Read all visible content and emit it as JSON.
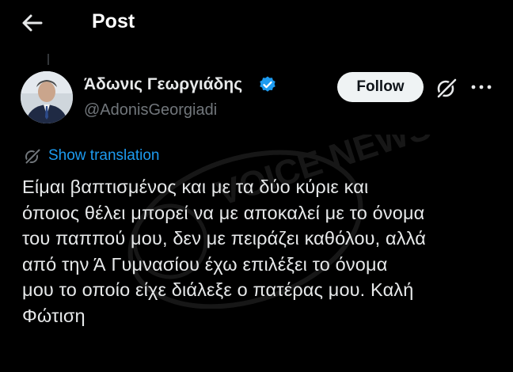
{
  "header": {
    "title": "Post",
    "back_icon": "arrow-left-icon"
  },
  "post": {
    "author_name": "Άδωνις Γεωργιάδης",
    "handle": "@AdonisGeorgiadi",
    "verified_color": "#1d9bf0",
    "follow_label": "Follow",
    "translate_label": "Show translation",
    "text": "Είμαι βαπτισμένος και με τα δύο κύριε και\nόποιος θέλει μπορεί να με αποκαλεί με το όνομα\nτου παππού μου, δεν με πειράζει καθόλου, αλλά\nαπό την Ά Γυμνασίου έχω επιλέξει το όνομα\nμου το οποίο είχε διάλεξε ο πατέρας μου. Καλή\nΦώτιση"
  },
  "watermark": {
    "text": "VOICE NEWS"
  },
  "colors": {
    "background": "#000000",
    "text": "#e7e9ea",
    "secondary": "#71767b",
    "accent": "#1d9bf0",
    "follow_bg": "#eff3f4"
  }
}
